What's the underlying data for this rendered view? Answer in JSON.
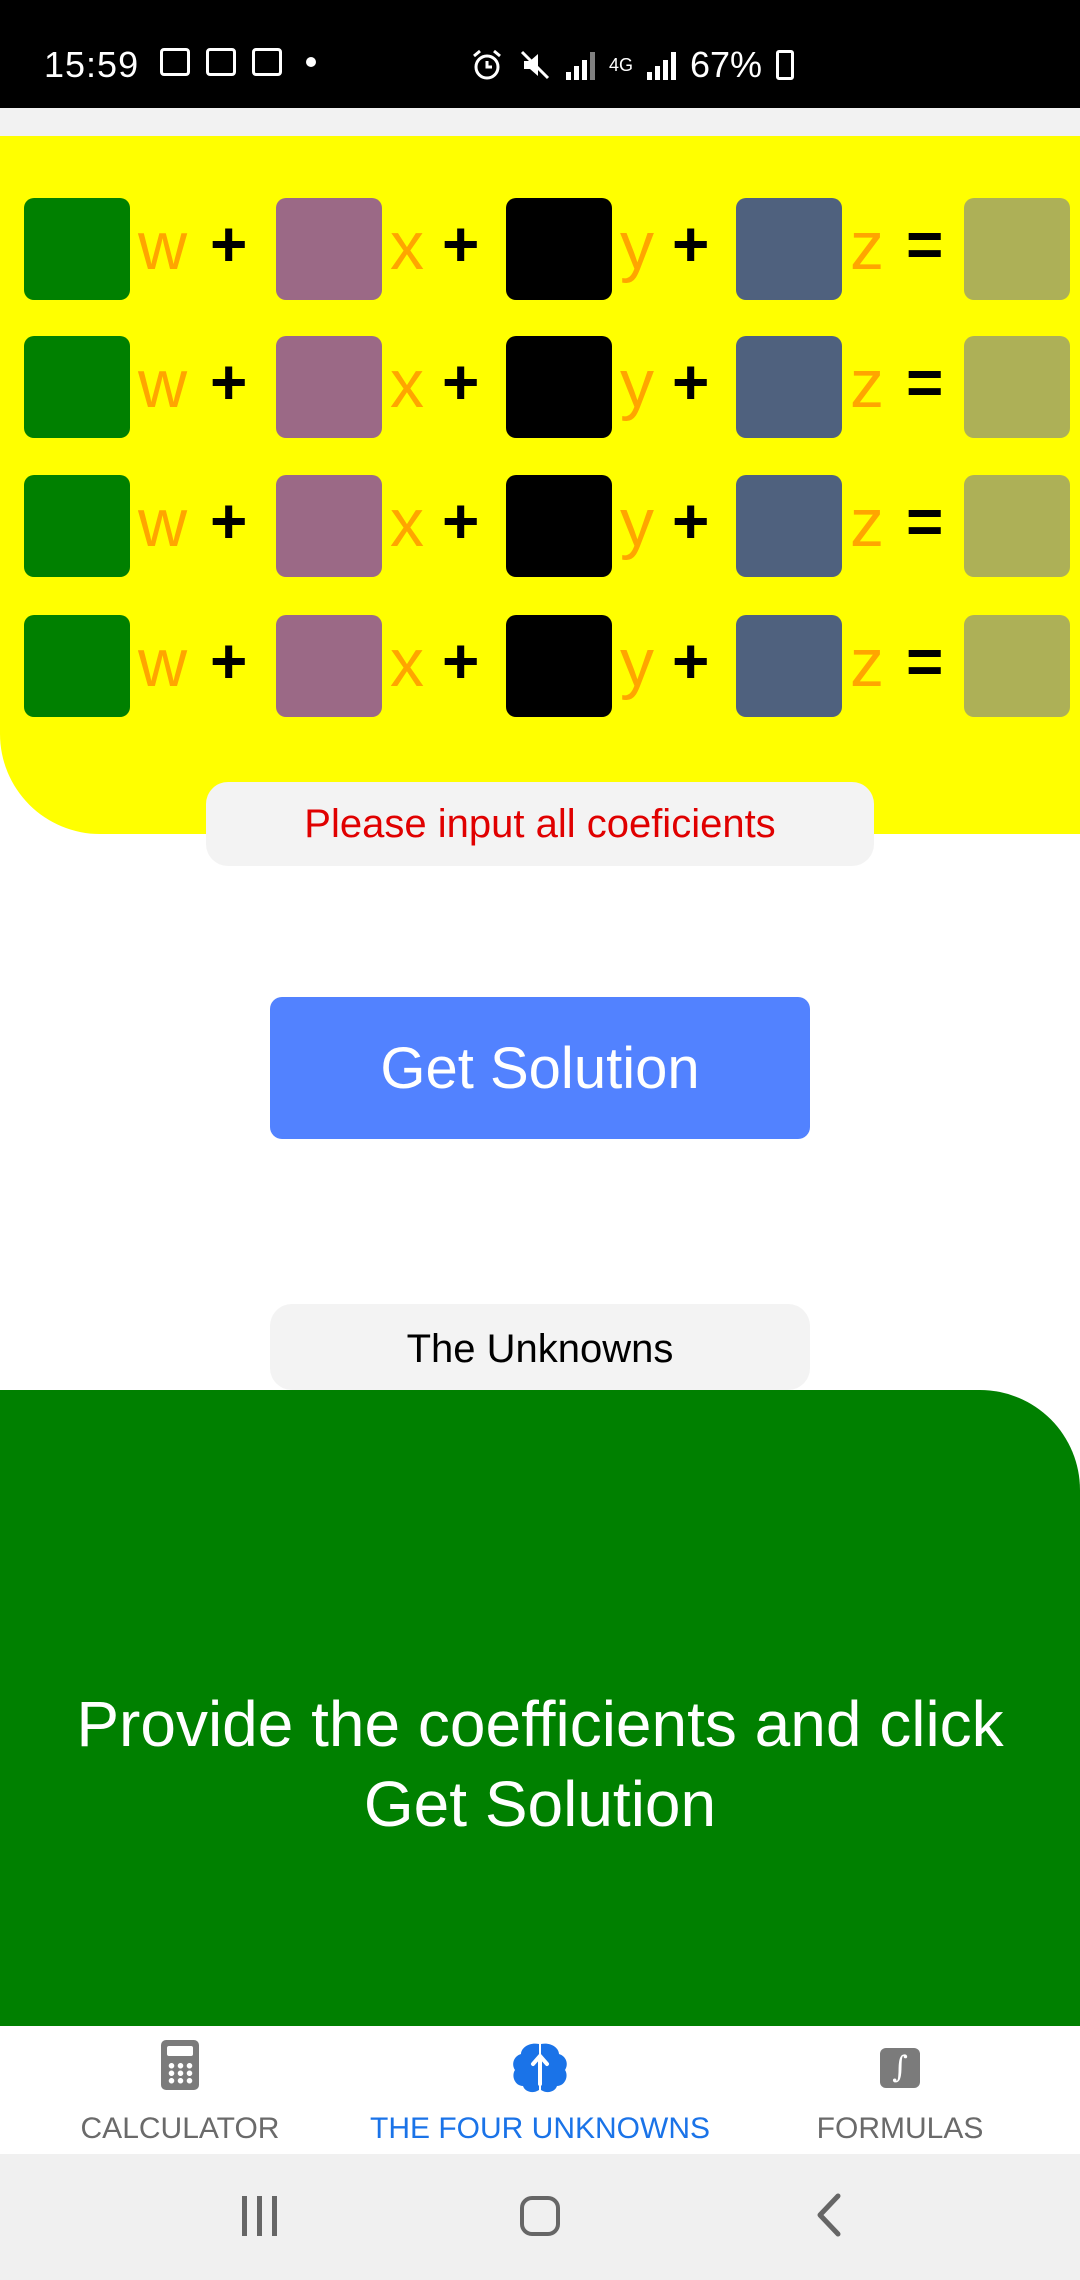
{
  "status_bar": {
    "time": "15:59",
    "battery": "67%",
    "network": "4G"
  },
  "equations": {
    "rows": [
      {
        "variables": [
          "w",
          "x",
          "y",
          "z"
        ],
        "plus": "+",
        "equals": "="
      },
      {
        "variables": [
          "w",
          "x",
          "y",
          "z"
        ],
        "plus": "+",
        "equals": "="
      },
      {
        "variables": [
          "w",
          "x",
          "y",
          "z"
        ],
        "plus": "+",
        "equals": "="
      },
      {
        "variables": [
          "w",
          "x",
          "y",
          "z"
        ],
        "plus": "+",
        "equals": "="
      }
    ],
    "coefficient_colors": {
      "w": "#008000",
      "x": "#9b6986",
      "y": "#000000",
      "z": "#4f617e",
      "result": "#adb057"
    },
    "background": "#ffff00"
  },
  "warning": {
    "text": "Please input all coeficients",
    "color": "#e00000"
  },
  "solve_button": {
    "label": "Get Solution",
    "color": "#5282ff"
  },
  "unknowns": {
    "label": "The Unknowns",
    "result_text": "Provide the coefficients and click Get Solution",
    "background": "#008000"
  },
  "bottom_nav": {
    "items": [
      {
        "label": "CALCULATOR",
        "icon": "calculator-icon",
        "active": false
      },
      {
        "label": "THE FOUR UNKNOWNS",
        "icon": "brain-icon",
        "active": true
      },
      {
        "label": "FORMULAS",
        "icon": "integral-icon",
        "active": false
      }
    ],
    "active_color": "#1a73e8"
  }
}
